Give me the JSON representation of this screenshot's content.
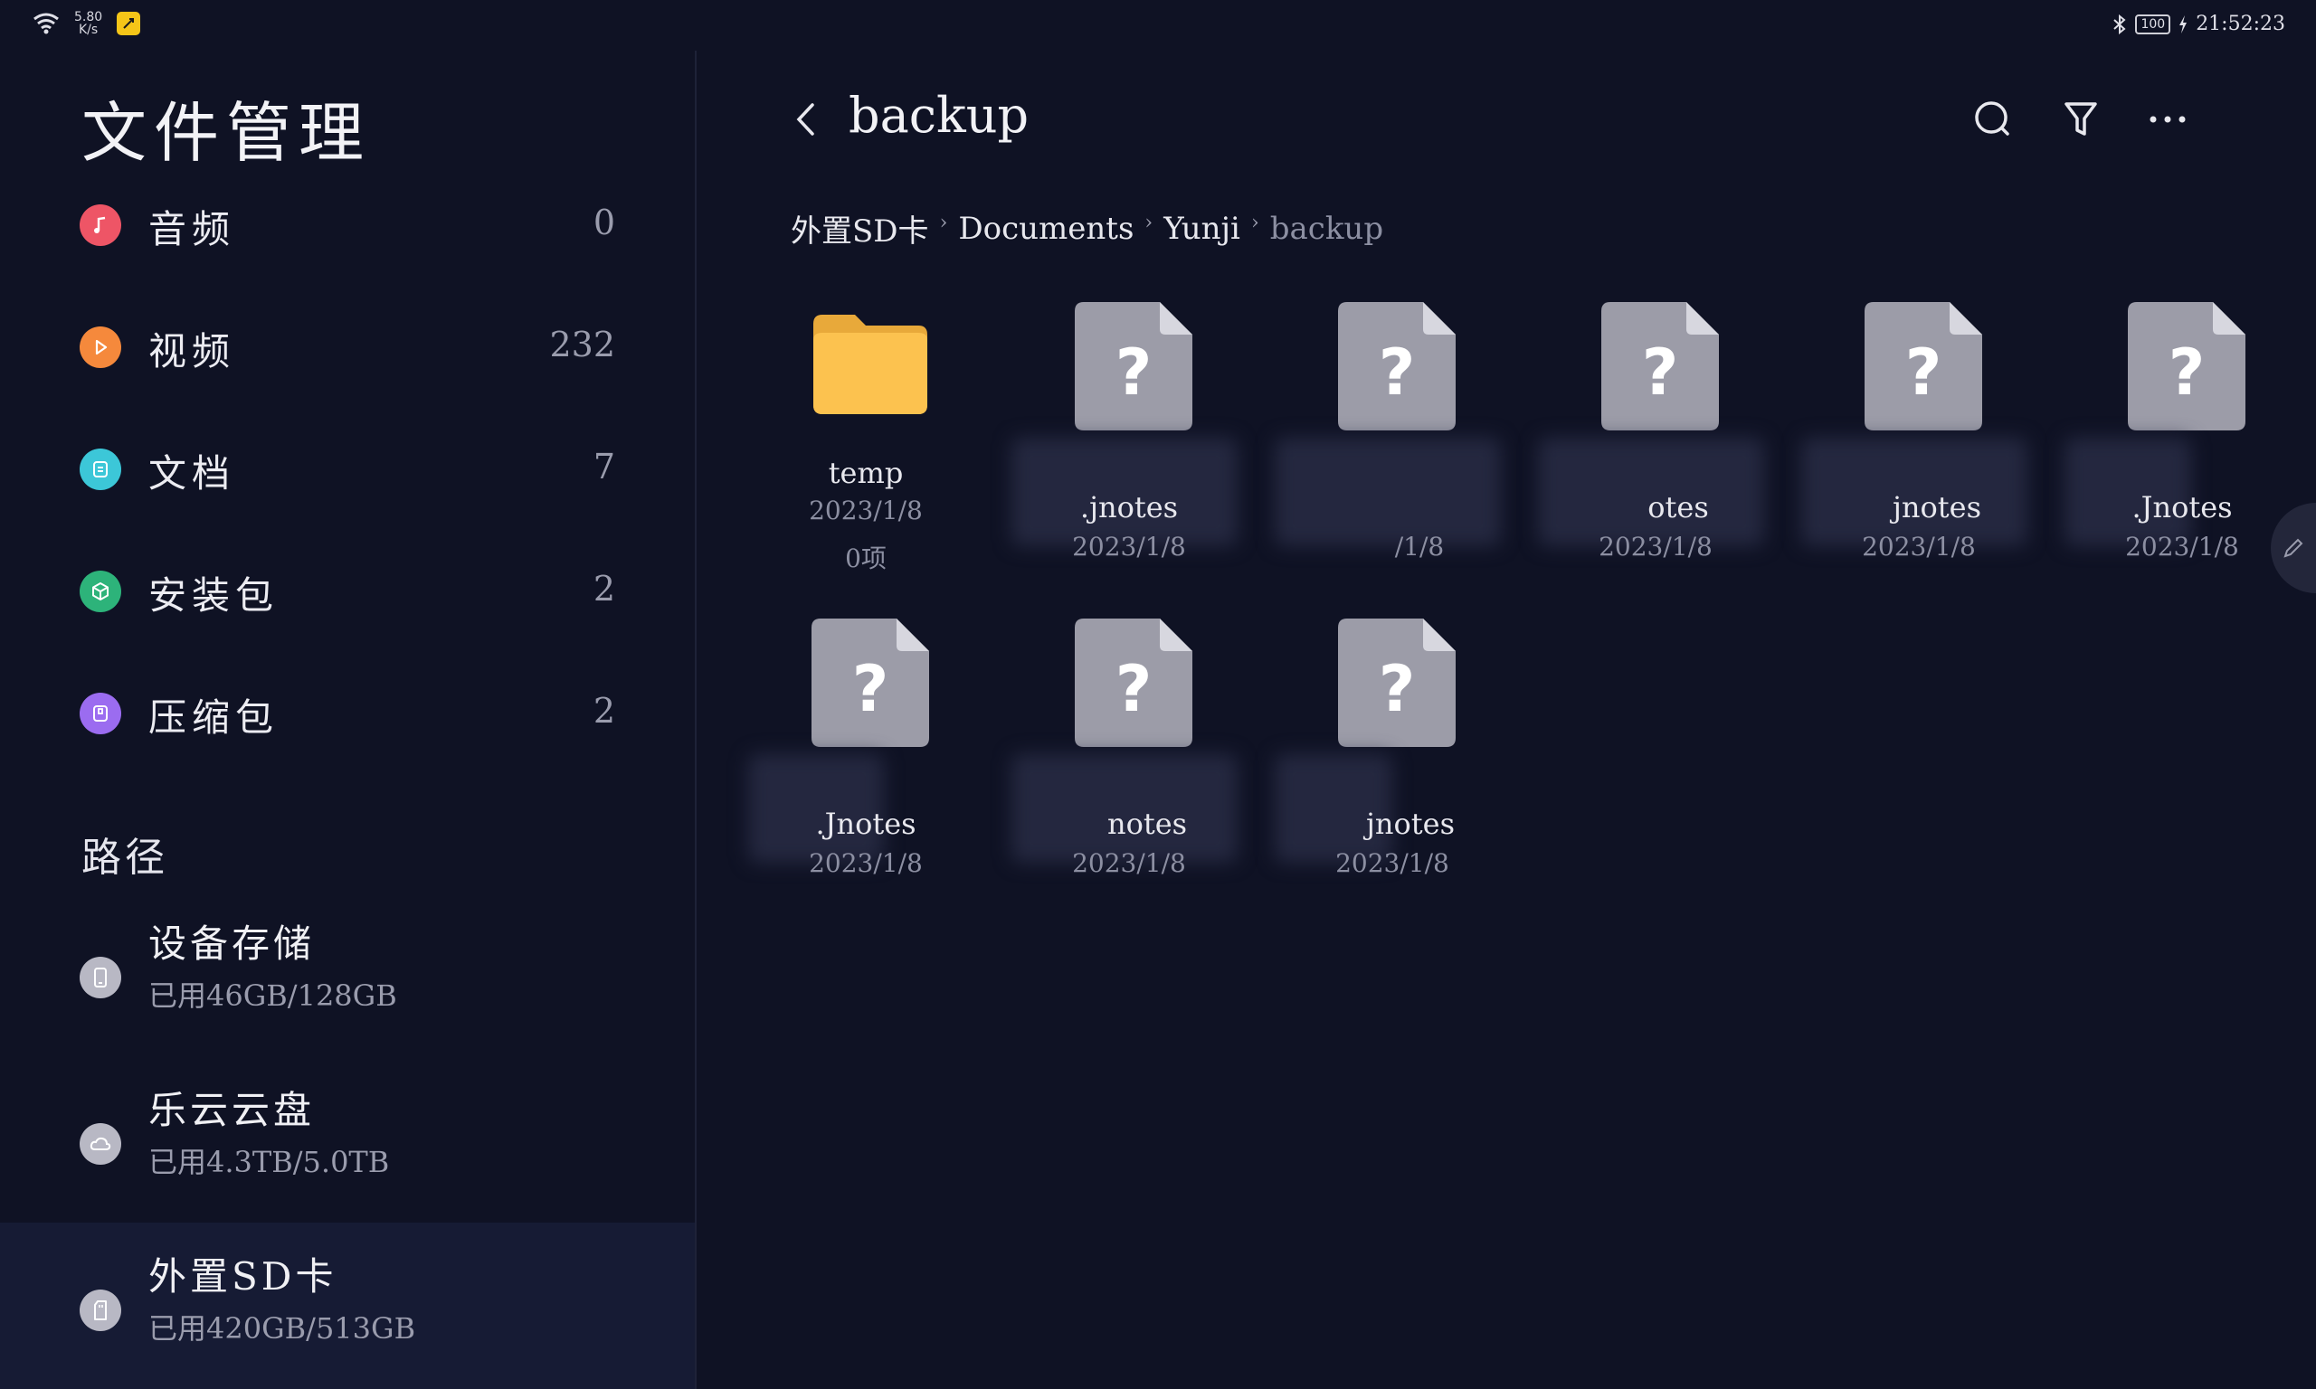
{
  "status_bar": {
    "net_speed_value": "5.80",
    "net_speed_unit": "K/s",
    "battery": "100",
    "time": "21:52:23"
  },
  "sidebar": {
    "title": "文件管理",
    "categories": [
      {
        "label": "音频",
        "count": "0",
        "color": "#ee5566"
      },
      {
        "label": "视频",
        "count": "232",
        "color": "#f5893c"
      },
      {
        "label": "文档",
        "count": "7",
        "color": "#3cc7d8"
      },
      {
        "label": "安装包",
        "count": "2",
        "color": "#2db37a"
      },
      {
        "label": "压缩包",
        "count": "2",
        "color": "#9b6cf0"
      }
    ],
    "path_title": "路径",
    "storages": [
      {
        "name": "设备存储",
        "used": "已用46GB/128GB"
      },
      {
        "name": "乐云云盘",
        "used": "已用4.3TB/5.0TB"
      },
      {
        "name": "外置SD卡",
        "used": "已用420GB/513GB"
      }
    ]
  },
  "header": {
    "folder_title": "backup"
  },
  "breadcrumb": {
    "items": [
      "外置SD卡",
      "Documents",
      "Yunji",
      "backup"
    ]
  },
  "files": [
    {
      "name": "temp",
      "date": "2023/1/8",
      "count": "0项",
      "type": "folder"
    },
    {
      "name": ".jnotes",
      "date": "2023/1/8",
      "type": "unknown"
    },
    {
      "name": "",
      "date": "/1/8",
      "type": "unknown"
    },
    {
      "name": "otes",
      "date": "2023/1/8",
      "type": "unknown"
    },
    {
      "name": "jnotes",
      "date": "2023/1/8",
      "type": "unknown"
    },
    {
      "name": ".Jnotes",
      "date": "2023/1/8",
      "type": "unknown"
    },
    {
      "name": ".Jnotes",
      "date": "2023/1/8",
      "type": "unknown"
    },
    {
      "name": "notes",
      "date": "2023/1/8",
      "type": "unknown"
    },
    {
      "name": "jnotes",
      "date": "2023/1/8",
      "type": "unknown"
    }
  ],
  "colors": {
    "background": "#0f1224",
    "active_row": "#161b34",
    "folder": "#fcc24f",
    "unknown_file": "#9c9ca8"
  }
}
